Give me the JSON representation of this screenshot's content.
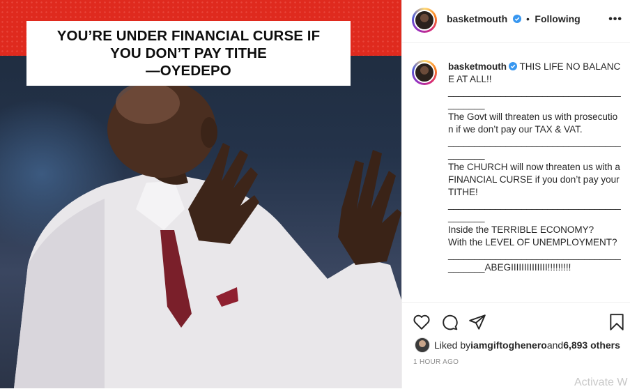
{
  "post_image": {
    "headline_lines": [
      "YOU’RE UNDER FINANCIAL CURSE IF",
      "YOU DON’T PAY TITHE",
      "—OYEDEPO"
    ]
  },
  "header": {
    "username": "basketmouth",
    "separator": "•",
    "follow_state": "Following",
    "more_icon": "more-horizontal-icon"
  },
  "caption": {
    "username": "basketmouth",
    "text": " THIS LIFE NO BALANCE AT ALL!!\n________________________________________\nThe Govt will threaten us with prosecution if we don’t pay our TAX & VAT.\n________________________________________\nThe CHURCH will now threaten us with a FINANCIAL CURSE if you don’t pay your TITHE!\n________________________________________\nInside the TERRIBLE ECONOMY?\nWith the LEVEL OF UNEMPLOYMENT?\n________________________________________ABEGIIIIIIIIIIIIII!!!!!!!!!"
  },
  "actions": {
    "icons": [
      "heart-icon",
      "comment-icon",
      "share-icon",
      "bookmark-icon"
    ]
  },
  "likes": {
    "prefix": "Liked by ",
    "user": "iamgiftoghenero",
    "middle": " and ",
    "others": "6,893 others"
  },
  "timestamp": "1 HOUR AGO",
  "watermark": "Activate W",
  "colors": {
    "brand_red": "#df2a1e",
    "verified_blue": "#3897f0",
    "text": "#262626",
    "muted": "#8e8e8e"
  }
}
